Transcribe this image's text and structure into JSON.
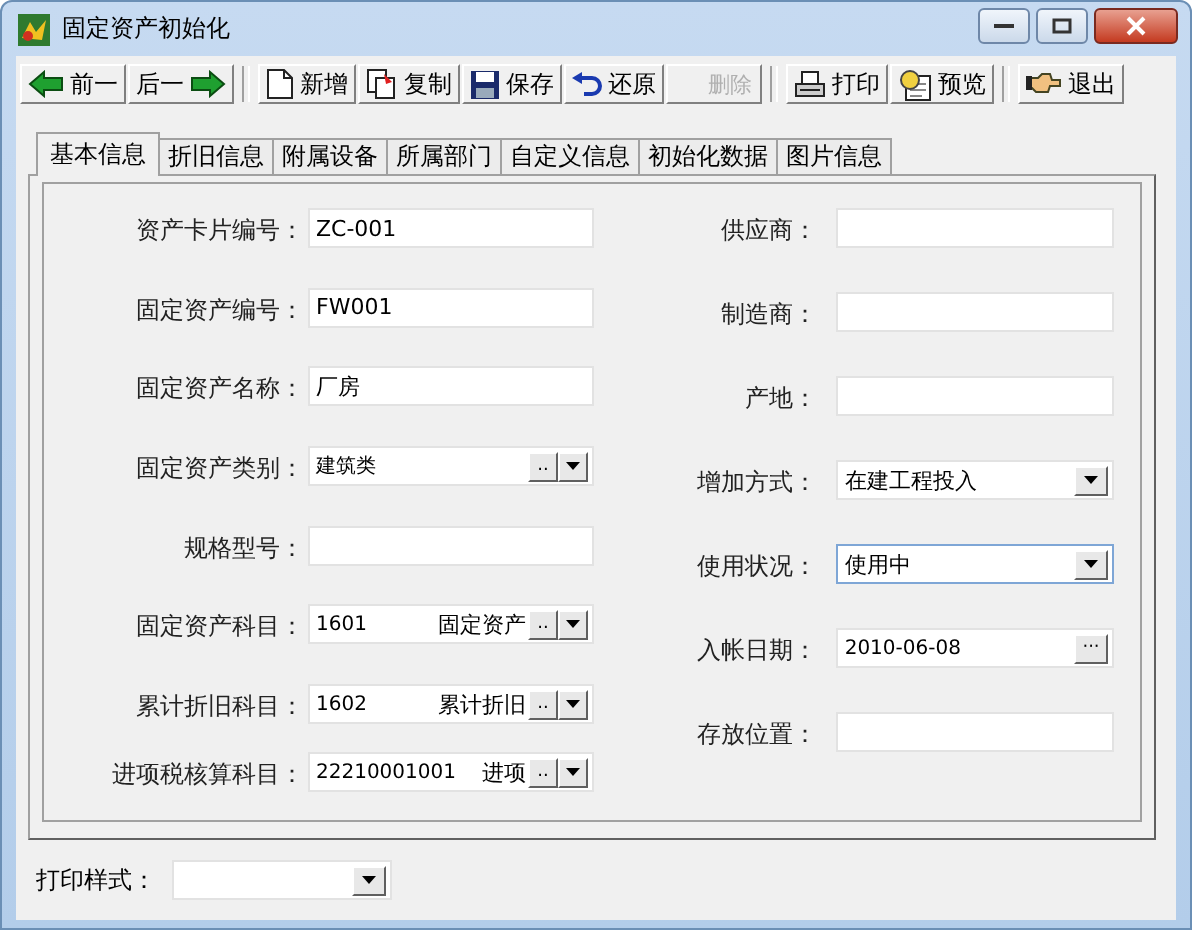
{
  "window": {
    "title": "固定资产初始化"
  },
  "toolbar": [
    {
      "label": "前一",
      "kind": "left",
      "disabled": false
    },
    {
      "label": "后一",
      "kind": "right",
      "disabled": false
    },
    {
      "label": "新增",
      "kind": "new",
      "disabled": false
    },
    {
      "label": "复制",
      "kind": "copy",
      "disabled": false
    },
    {
      "label": "保存",
      "kind": "save",
      "disabled": false
    },
    {
      "label": "还原",
      "kind": "undo",
      "disabled": false
    },
    {
      "label": "删除",
      "kind": "plain",
      "disabled": true
    },
    {
      "label": "打印",
      "kind": "print",
      "disabled": false
    },
    {
      "label": "预览",
      "kind": "preview",
      "disabled": false
    },
    {
      "label": "退出",
      "kind": "exit",
      "disabled": false
    }
  ],
  "tabs": [
    {
      "label": "基本信息",
      "selected": true
    },
    {
      "label": "折旧信息",
      "selected": false
    },
    {
      "label": "附属设备",
      "selected": false
    },
    {
      "label": "所属部门",
      "selected": false
    },
    {
      "label": "自定义信息",
      "selected": false
    },
    {
      "label": "初始化数据",
      "selected": false
    },
    {
      "label": "图片信息",
      "selected": false
    }
  ],
  "left_fields": [
    {
      "label": "资产卡片编号：",
      "kind": "text",
      "value": "ZC-001"
    },
    {
      "label": "固定资产编号：",
      "kind": "text",
      "value": "FW001"
    },
    {
      "label": "固定资产名称：",
      "kind": "text",
      "value": "厂房"
    },
    {
      "label": "固定资产类别：",
      "kind": "picker",
      "value": "建筑类",
      "button": ".."
    },
    {
      "label": "规格型号：",
      "kind": "text"
    },
    {
      "label": "固定资产科目：",
      "kind": "picker",
      "value": "1601",
      "extra": "固定资产",
      "button": ".."
    },
    {
      "label": "累计折旧科目：",
      "kind": "picker",
      "value": "1602",
      "extra": "累计折旧",
      "button": ".."
    },
    {
      "label": "进项税核算科目：",
      "kind": "picker",
      "value": "22210001001",
      "extra": "进项",
      "button": ".."
    }
  ],
  "right_fields": [
    {
      "label": "供应商：",
      "kind": "text"
    },
    {
      "label": "制造商：",
      "kind": "text"
    },
    {
      "label": "产地：",
      "kind": "text"
    },
    {
      "label": "增加方式：",
      "kind": "combo",
      "value": "在建工程投入"
    },
    {
      "label": "使用状况：",
      "kind": "combo",
      "value": "使用中"
    },
    {
      "label": "入帐日期：",
      "kind": "date",
      "value": "2010-06-08",
      "button": "···"
    },
    {
      "label": "存放位置：",
      "kind": "text"
    }
  ],
  "print_style": {
    "label": "打印样式："
  }
}
